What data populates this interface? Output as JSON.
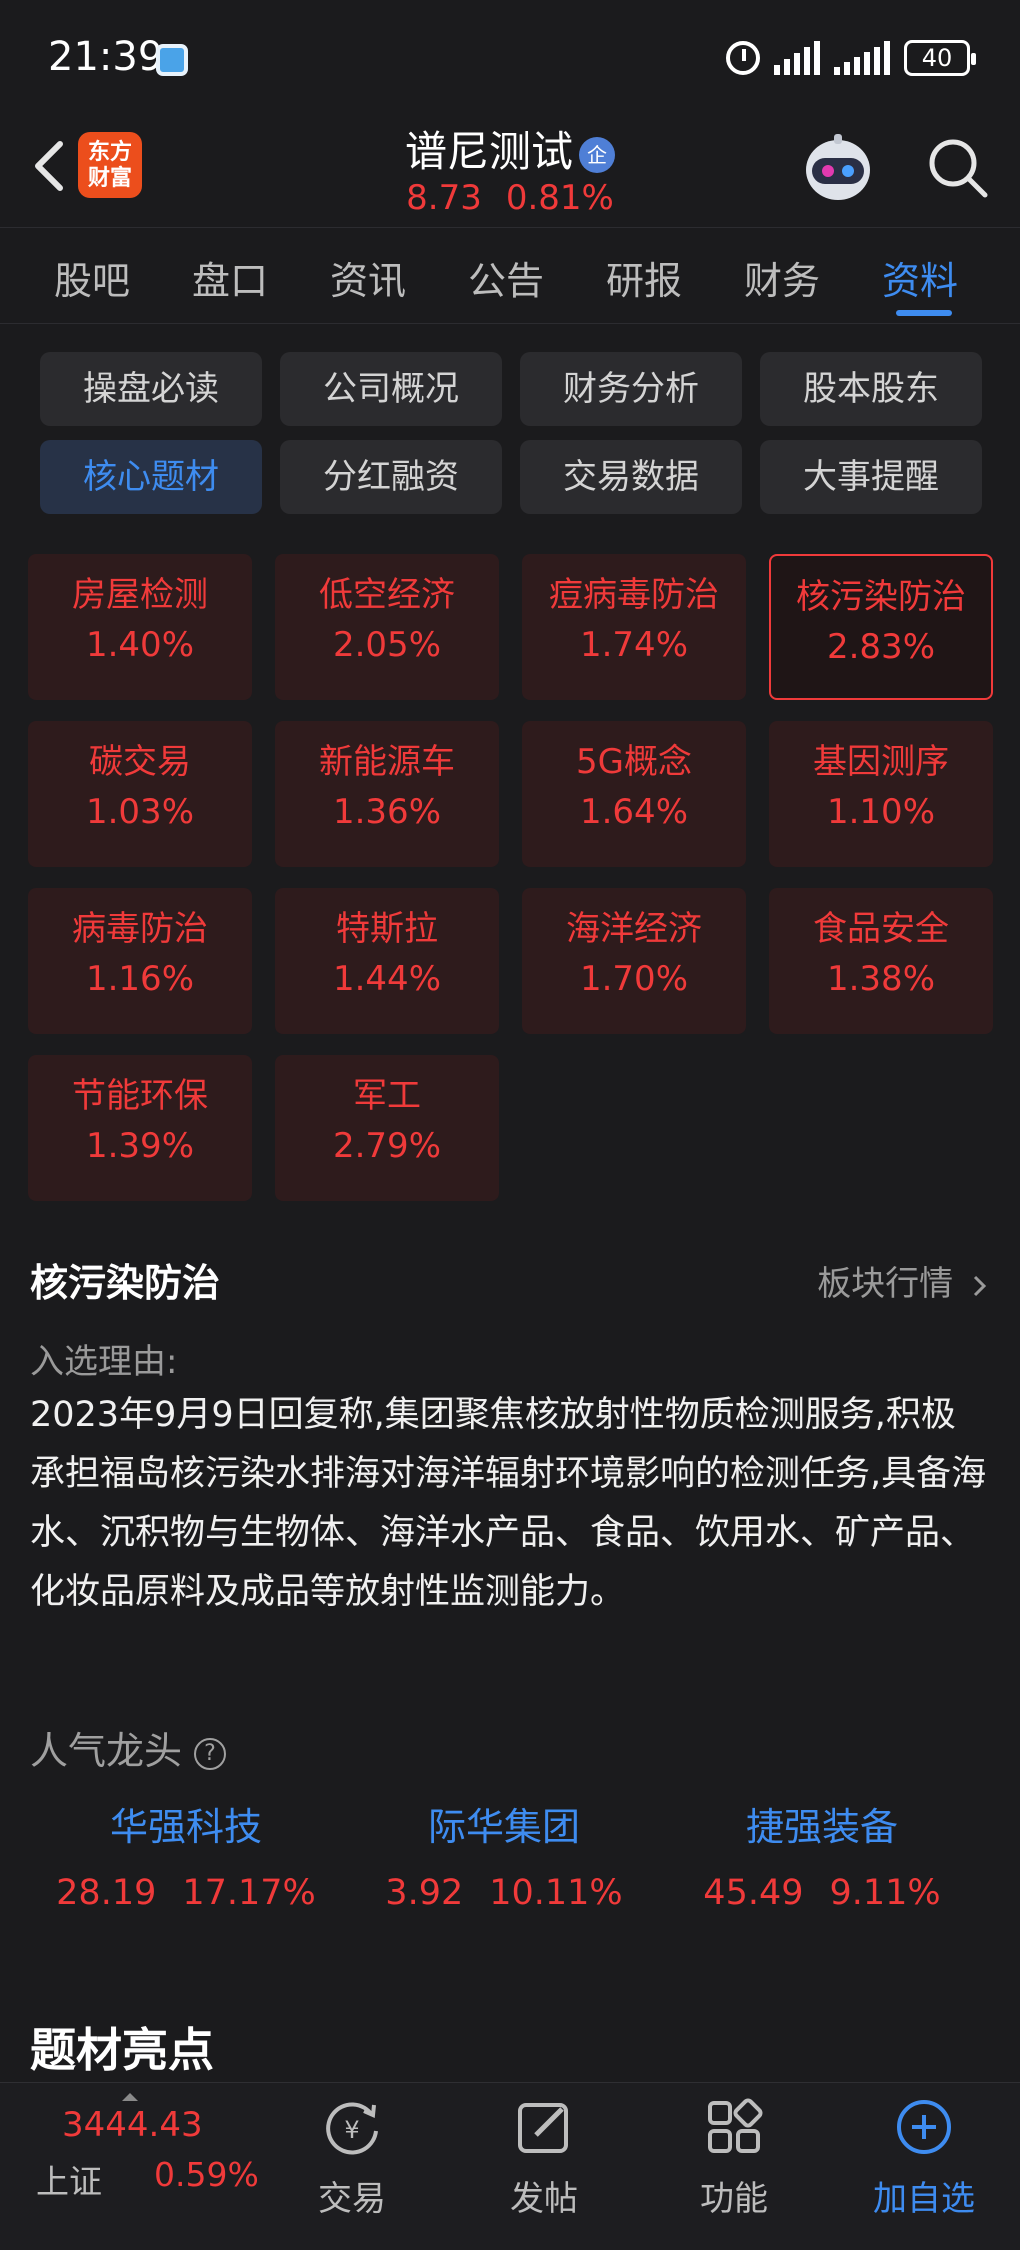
{
  "status": {
    "time": "21:39",
    "battery": "40"
  },
  "header": {
    "logo_line1": "东方",
    "logo_line2": "财富",
    "title": "谱尼测试",
    "title_badge": "企",
    "price": "8.73",
    "change_pct": "0.81%"
  },
  "tabs": [
    "股吧",
    "盘口",
    "资讯",
    "公告",
    "研报",
    "财务",
    "资料"
  ],
  "active_tab": "资料",
  "subtabs": [
    "操盘必读",
    "公司概况",
    "财务分析",
    "股本股东",
    "核心题材",
    "分红融资",
    "交易数据",
    "大事提醒"
  ],
  "active_subtab": "核心题材",
  "themes": [
    {
      "name": "房屋检测",
      "pct": "1.40%"
    },
    {
      "name": "低空经济",
      "pct": "2.05%"
    },
    {
      "name": "痘病毒防治",
      "pct": "1.74%"
    },
    {
      "name": "核污染防治",
      "pct": "2.83%",
      "selected": true
    },
    {
      "name": "碳交易",
      "pct": "1.03%"
    },
    {
      "name": "新能源车",
      "pct": "1.36%"
    },
    {
      "name": "5G概念",
      "pct": "1.64%"
    },
    {
      "name": "基因测序",
      "pct": "1.10%"
    },
    {
      "name": "病毒防治",
      "pct": "1.16%"
    },
    {
      "name": "特斯拉",
      "pct": "1.44%"
    },
    {
      "name": "海洋经济",
      "pct": "1.70%"
    },
    {
      "name": "食品安全",
      "pct": "1.38%"
    },
    {
      "name": "节能环保",
      "pct": "1.39%"
    },
    {
      "name": "军工",
      "pct": "2.79%"
    }
  ],
  "detail": {
    "title": "核污染防治",
    "sector_link": "板块行情",
    "reason_label": "入选理由:",
    "reason_text": "2023年9月9日回复称,集团聚焦核放射性物质检测服务,积极承担福岛核污染水排海对海洋辐射环境影响的检测任务,具备海水、沉积物与生物体、海洋水产品、食品、饮用水、矿产品、化妆品原料及成品等放射性监测能力。"
  },
  "popular": {
    "title": "人气龙头",
    "leaders": [
      {
        "name": "华强科技",
        "price": "28.19",
        "pct": "17.17%"
      },
      {
        "name": "际华集团",
        "price": "3.92",
        "pct": "10.11%"
      },
      {
        "name": "捷强装备",
        "price": "45.49",
        "pct": "9.11%"
      }
    ]
  },
  "highlights_title": "题材亮点",
  "bottom": {
    "index_value": "3444.43",
    "index_name": "上证",
    "index_pct": "0.59%",
    "items": [
      {
        "label": "交易",
        "icon": "yuan-cycle-icon"
      },
      {
        "label": "发帖",
        "icon": "edit-icon"
      },
      {
        "label": "功能",
        "icon": "grid-icon"
      },
      {
        "label": "加自选",
        "icon": "add-circle-icon"
      }
    ]
  },
  "colors": {
    "up": "#f03a3a",
    "accent": "#3e8cf0",
    "background": "#1b1b1d"
  }
}
